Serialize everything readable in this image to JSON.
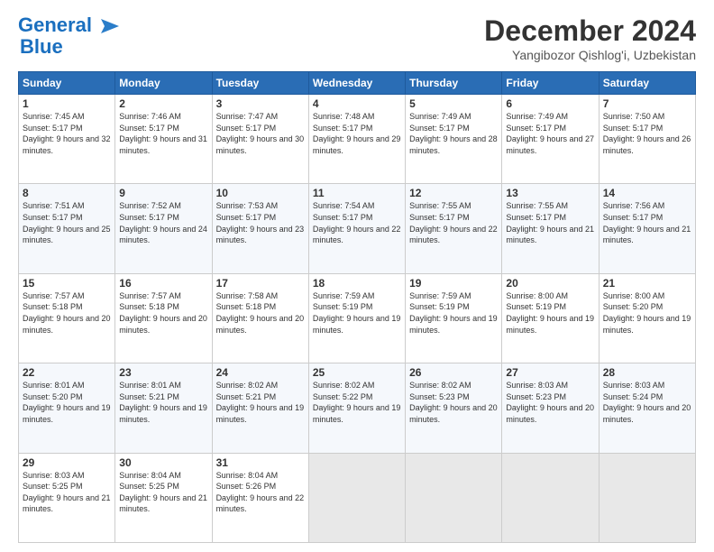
{
  "header": {
    "logo_line1": "General",
    "logo_line2": "Blue",
    "month_year": "December 2024",
    "location": "Yangibozor Qishlog'i, Uzbekistan"
  },
  "weekdays": [
    "Sunday",
    "Monday",
    "Tuesday",
    "Wednesday",
    "Thursday",
    "Friday",
    "Saturday"
  ],
  "weeks": [
    [
      {
        "day": "1",
        "sunrise": "Sunrise: 7:45 AM",
        "sunset": "Sunset: 5:17 PM",
        "daylight": "Daylight: 9 hours and 32 minutes."
      },
      {
        "day": "2",
        "sunrise": "Sunrise: 7:46 AM",
        "sunset": "Sunset: 5:17 PM",
        "daylight": "Daylight: 9 hours and 31 minutes."
      },
      {
        "day": "3",
        "sunrise": "Sunrise: 7:47 AM",
        "sunset": "Sunset: 5:17 PM",
        "daylight": "Daylight: 9 hours and 30 minutes."
      },
      {
        "day": "4",
        "sunrise": "Sunrise: 7:48 AM",
        "sunset": "Sunset: 5:17 PM",
        "daylight": "Daylight: 9 hours and 29 minutes."
      },
      {
        "day": "5",
        "sunrise": "Sunrise: 7:49 AM",
        "sunset": "Sunset: 5:17 PM",
        "daylight": "Daylight: 9 hours and 28 minutes."
      },
      {
        "day": "6",
        "sunrise": "Sunrise: 7:49 AM",
        "sunset": "Sunset: 5:17 PM",
        "daylight": "Daylight: 9 hours and 27 minutes."
      },
      {
        "day": "7",
        "sunrise": "Sunrise: 7:50 AM",
        "sunset": "Sunset: 5:17 PM",
        "daylight": "Daylight: 9 hours and 26 minutes."
      }
    ],
    [
      {
        "day": "8",
        "sunrise": "Sunrise: 7:51 AM",
        "sunset": "Sunset: 5:17 PM",
        "daylight": "Daylight: 9 hours and 25 minutes."
      },
      {
        "day": "9",
        "sunrise": "Sunrise: 7:52 AM",
        "sunset": "Sunset: 5:17 PM",
        "daylight": "Daylight: 9 hours and 24 minutes."
      },
      {
        "day": "10",
        "sunrise": "Sunrise: 7:53 AM",
        "sunset": "Sunset: 5:17 PM",
        "daylight": "Daylight: 9 hours and 23 minutes."
      },
      {
        "day": "11",
        "sunrise": "Sunrise: 7:54 AM",
        "sunset": "Sunset: 5:17 PM",
        "daylight": "Daylight: 9 hours and 22 minutes."
      },
      {
        "day": "12",
        "sunrise": "Sunrise: 7:55 AM",
        "sunset": "Sunset: 5:17 PM",
        "daylight": "Daylight: 9 hours and 22 minutes."
      },
      {
        "day": "13",
        "sunrise": "Sunrise: 7:55 AM",
        "sunset": "Sunset: 5:17 PM",
        "daylight": "Daylight: 9 hours and 21 minutes."
      },
      {
        "day": "14",
        "sunrise": "Sunrise: 7:56 AM",
        "sunset": "Sunset: 5:17 PM",
        "daylight": "Daylight: 9 hours and 21 minutes."
      }
    ],
    [
      {
        "day": "15",
        "sunrise": "Sunrise: 7:57 AM",
        "sunset": "Sunset: 5:18 PM",
        "daylight": "Daylight: 9 hours and 20 minutes."
      },
      {
        "day": "16",
        "sunrise": "Sunrise: 7:57 AM",
        "sunset": "Sunset: 5:18 PM",
        "daylight": "Daylight: 9 hours and 20 minutes."
      },
      {
        "day": "17",
        "sunrise": "Sunrise: 7:58 AM",
        "sunset": "Sunset: 5:18 PM",
        "daylight": "Daylight: 9 hours and 20 minutes."
      },
      {
        "day": "18",
        "sunrise": "Sunrise: 7:59 AM",
        "sunset": "Sunset: 5:19 PM",
        "daylight": "Daylight: 9 hours and 19 minutes."
      },
      {
        "day": "19",
        "sunrise": "Sunrise: 7:59 AM",
        "sunset": "Sunset: 5:19 PM",
        "daylight": "Daylight: 9 hours and 19 minutes."
      },
      {
        "day": "20",
        "sunrise": "Sunrise: 8:00 AM",
        "sunset": "Sunset: 5:19 PM",
        "daylight": "Daylight: 9 hours and 19 minutes."
      },
      {
        "day": "21",
        "sunrise": "Sunrise: 8:00 AM",
        "sunset": "Sunset: 5:20 PM",
        "daylight": "Daylight: 9 hours and 19 minutes."
      }
    ],
    [
      {
        "day": "22",
        "sunrise": "Sunrise: 8:01 AM",
        "sunset": "Sunset: 5:20 PM",
        "daylight": "Daylight: 9 hours and 19 minutes."
      },
      {
        "day": "23",
        "sunrise": "Sunrise: 8:01 AM",
        "sunset": "Sunset: 5:21 PM",
        "daylight": "Daylight: 9 hours and 19 minutes."
      },
      {
        "day": "24",
        "sunrise": "Sunrise: 8:02 AM",
        "sunset": "Sunset: 5:21 PM",
        "daylight": "Daylight: 9 hours and 19 minutes."
      },
      {
        "day": "25",
        "sunrise": "Sunrise: 8:02 AM",
        "sunset": "Sunset: 5:22 PM",
        "daylight": "Daylight: 9 hours and 19 minutes."
      },
      {
        "day": "26",
        "sunrise": "Sunrise: 8:02 AM",
        "sunset": "Sunset: 5:23 PM",
        "daylight": "Daylight: 9 hours and 20 minutes."
      },
      {
        "day": "27",
        "sunrise": "Sunrise: 8:03 AM",
        "sunset": "Sunset: 5:23 PM",
        "daylight": "Daylight: 9 hours and 20 minutes."
      },
      {
        "day": "28",
        "sunrise": "Sunrise: 8:03 AM",
        "sunset": "Sunset: 5:24 PM",
        "daylight": "Daylight: 9 hours and 20 minutes."
      }
    ],
    [
      {
        "day": "29",
        "sunrise": "Sunrise: 8:03 AM",
        "sunset": "Sunset: 5:25 PM",
        "daylight": "Daylight: 9 hours and 21 minutes."
      },
      {
        "day": "30",
        "sunrise": "Sunrise: 8:04 AM",
        "sunset": "Sunset: 5:25 PM",
        "daylight": "Daylight: 9 hours and 21 minutes."
      },
      {
        "day": "31",
        "sunrise": "Sunrise: 8:04 AM",
        "sunset": "Sunset: 5:26 PM",
        "daylight": "Daylight: 9 hours and 22 minutes."
      },
      null,
      null,
      null,
      null
    ]
  ]
}
